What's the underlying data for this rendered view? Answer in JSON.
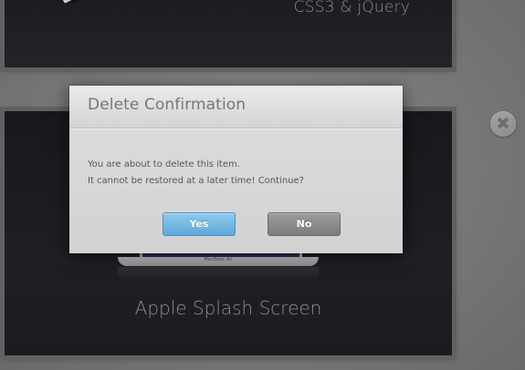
{
  "cards": {
    "top_title": "CSS3 & jQuery",
    "bottom_title": "Apple Splash Screen",
    "laptop_label": "MacBook Air"
  },
  "close_button": {
    "glyph": "✖",
    "icon": "close-icon"
  },
  "dialog": {
    "title": "Delete Confirmation",
    "message_line_1": "You are about to delete this item.",
    "message_line_2": "It cannot be restored at a later time! Continue?",
    "yes_label": "Yes",
    "no_label": "No"
  },
  "colors": {
    "yes_button": "#5fa8d8",
    "no_button": "#7c7c7c",
    "card_background": "#1d1d22",
    "page_background": "#7a7a7a"
  }
}
